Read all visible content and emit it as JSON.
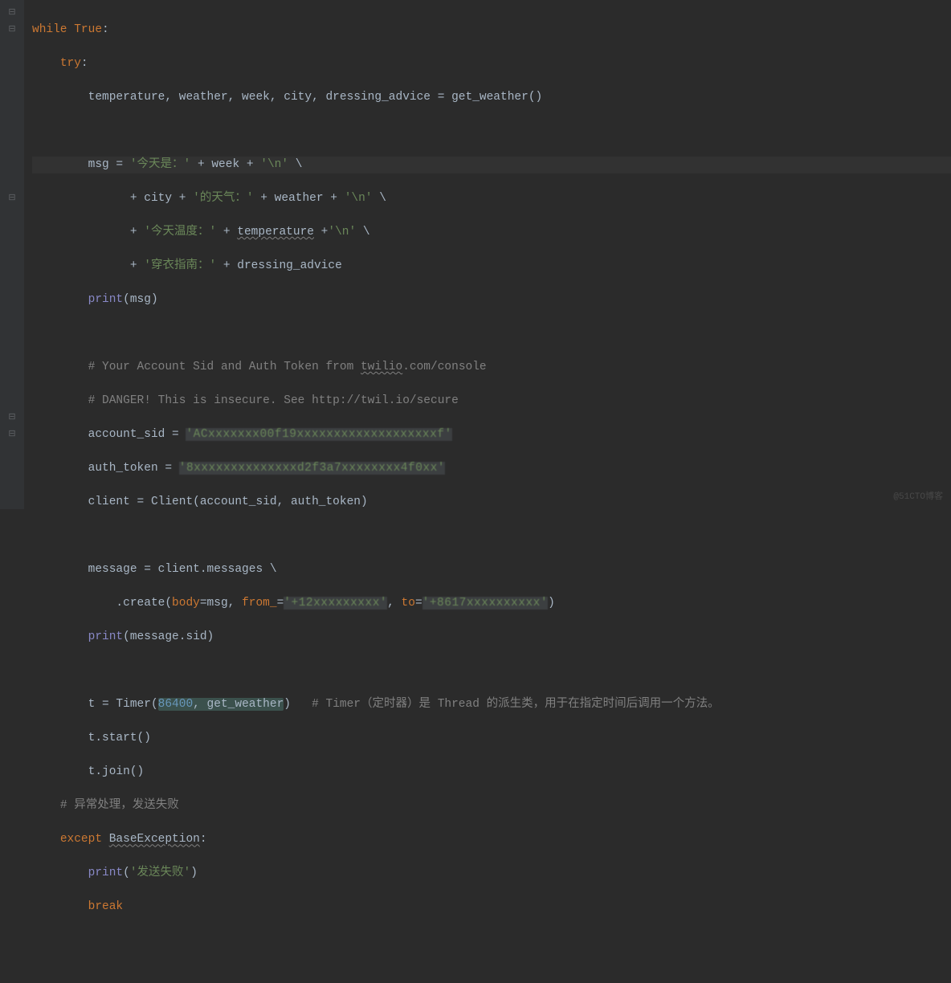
{
  "watermark": "@51CTO博客",
  "code": {
    "l1": {
      "kw1": "while ",
      "kw2": "True",
      "colon": ":"
    },
    "l2": {
      "kw": "try",
      "colon": ":"
    },
    "l3": {
      "vars": "temperature, weather, week, city, dressing_advice = get_weather()"
    },
    "l4": {
      "var": "msg = ",
      "s1": "'今天是：'",
      "plus1": " + week + ",
      "s2": "'\\n'",
      "cont": " \\"
    },
    "l5": {
      "pad": "      + city + ",
      "s1": "'的天气：'",
      "plus1": " + weather + ",
      "s2": "'\\n'",
      "cont": " \\"
    },
    "l6": {
      "pad": "      + ",
      "s1": "'今天温度：'",
      "plus1": " + ",
      "sq": "temperature",
      "plus2": " +",
      "s2": "'\\n'",
      "cont": " \\"
    },
    "l7": {
      "pad": "      + ",
      "s1": "'穿衣指南：'",
      "plus1": " + dressing_advice"
    },
    "l8": {
      "fn": "print",
      "arg": "(msg)"
    },
    "l9": {
      "c": "# Your Account Sid and Auth Token from ",
      "sq": "twilio",
      "c2": ".com/console"
    },
    "l10": {
      "c": "# DANGER! This is insecure. See http://twil.io/secure"
    },
    "l11": {
      "var": "account_sid = ",
      "s": "'ACxxxxxxx00f19xxxxxxxxxxxxxxxxxxxf'"
    },
    "l12": {
      "var": "auth_token = ",
      "s": "'8xxxxxxxxxxxxxxd2f3a7xxxxxxxx4f0xx'"
    },
    "l13": {
      "var": "client = Client(account_sid, auth_token)"
    },
    "l14": {
      "var": "message = client.messages \\"
    },
    "l15": {
      "pad": "    .create(",
      "k1": "body",
      "eq1": "=msg, ",
      "k2": "from_",
      "eq2": "=",
      "s1": "'+12xxxxxxxxx'",
      "comma": ", ",
      "k3": "to",
      "eq3": "=",
      "s2": "'+8617xxxxxxxxxx'",
      "close": ")"
    },
    "l16": {
      "fn": "print",
      "arg": "(message.sid)"
    },
    "l17": {
      "var": "t = Timer(",
      "hl": "86400, get_weather",
      "close": ")",
      "c": "   # Timer（定时器）是 Thread 的派生类，用于在指定时间后调用一个方法。"
    },
    "l18": {
      "var": "t.start()"
    },
    "l19": {
      "var": "t.join()"
    },
    "l20": {
      "c": "# 异常处理，发送失败"
    },
    "l21": {
      "kw": "except ",
      "sq": "BaseException",
      "colon": ":"
    },
    "l22": {
      "fn": "print",
      "open": "(",
      "s": "'发送失败'",
      "close": ")"
    },
    "l23": {
      "kw": "break"
    }
  }
}
